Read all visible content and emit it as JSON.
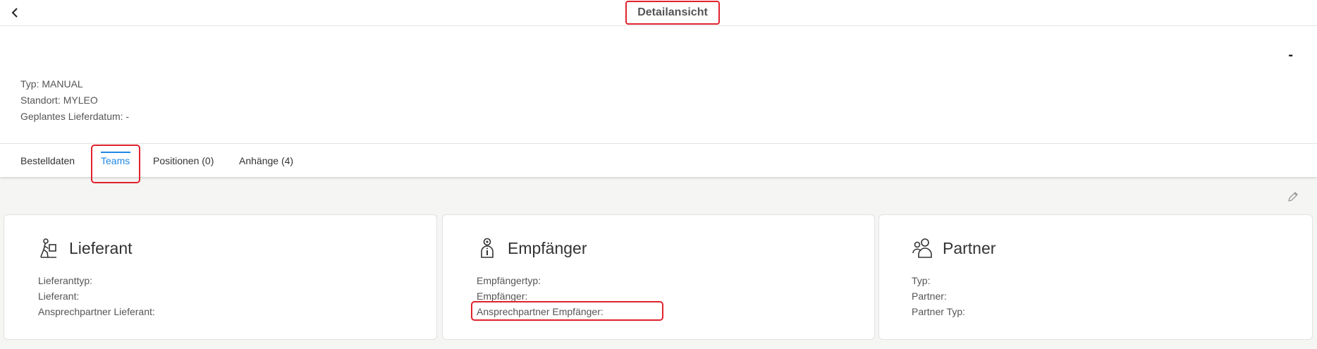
{
  "topbar": {
    "title": "Detailansicht",
    "back_icon": "chevron-left-icon"
  },
  "header": {
    "dash": "-",
    "type": "Typ: MANUAL",
    "location": "Standort: MYLEO",
    "delivery": "Geplantes Lieferdatum: -"
  },
  "tabs": [
    {
      "label": "Bestelldaten"
    },
    {
      "label": "Teams",
      "active": true
    },
    {
      "label": "Positionen (0)"
    },
    {
      "label": "Anhänge (4)"
    }
  ],
  "edit_icon": "pencil-icon",
  "cards": [
    {
      "title": "Lieferant",
      "icon": "supplier-icon",
      "fields": [
        "Lieferanttyp:",
        "Lieferant:",
        "Ansprechpartner Lieferant:"
      ]
    },
    {
      "title": "Empfänger",
      "icon": "recipient-icon",
      "fields": [
        "Empfängertyp:",
        "Empfänger:",
        "Ansprechpartner Empfänger:"
      ]
    },
    {
      "title": "Partner",
      "icon": "partner-icon",
      "fields": [
        "Typ:",
        "Partner:",
        "Partner Typ:"
      ]
    }
  ],
  "colors": {
    "accent": "#1e88e5",
    "highlight": "#e0222c"
  }
}
